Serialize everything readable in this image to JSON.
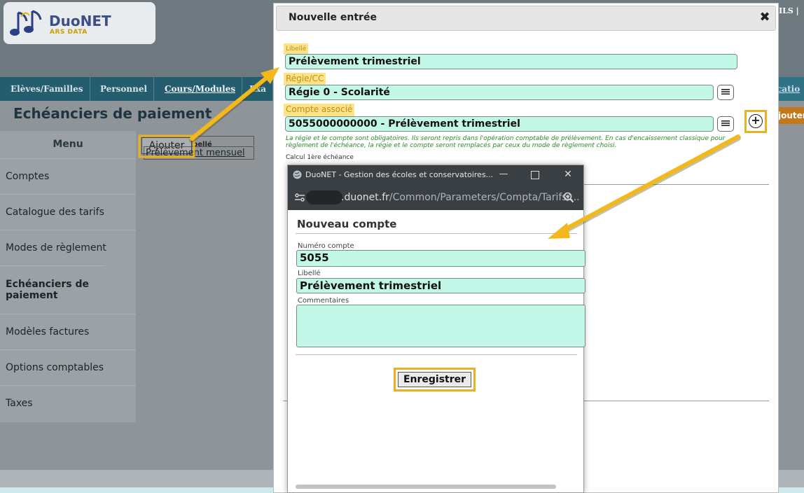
{
  "app": {
    "brand_name": "DuoNET",
    "brand_sub": "ARS DATA",
    "top_right_fragment": "ILS |"
  },
  "nav": {
    "items": [
      {
        "label": "Elèves/Familles"
      },
      {
        "label": "Personnel"
      },
      {
        "label": "Cours/Modules"
      },
      {
        "label": "Exa"
      }
    ],
    "right_fragment": "ocatio"
  },
  "page": {
    "title": "Echéanciers de paiement",
    "right_button_fragment": "jouter"
  },
  "sidebar": {
    "title": "Menu",
    "items": [
      {
        "label": "Comptes"
      },
      {
        "label": "Catalogue des tarifs"
      },
      {
        "label": "Modes de règlement"
      },
      {
        "label": "Echéanciers de paiement"
      },
      {
        "label": "Modèles factures"
      },
      {
        "label": "Options comptables"
      },
      {
        "label": "Taxes"
      }
    ]
  },
  "background_list": {
    "add_button": "Ajouter",
    "column_header": "Libellé",
    "rows": [
      "Prélèvement mensuel"
    ]
  },
  "modal": {
    "title": "Nouvelle entrée",
    "close_glyph": "✖",
    "libelle_label": "Libellé",
    "libelle_value": "Prélèvement trimestriel",
    "regie_label": "Régie/CC",
    "regie_value": "Régie 0 - Scolarité",
    "compte_label": "Compte associé",
    "compte_value": "5055000000000 - Prélèvement trimestriel",
    "add_glyph": "+",
    "note": "La régie et le compte sont obligatoires. Ils seront repris dans l'opération comptable de prélèvement. En cas d'encaissement classique pour règlement de l'échéance, la régie et le compte seront remplacés par ceux du mode de règlement choisi.",
    "calc_label": "Calcul 1ère échéance"
  },
  "popup": {
    "window_title": "DuoNET - Gestion des écoles et conservatoires...",
    "url_host": ".duonet.fr",
    "url_path": "/Common/Parameters/Compta/Tarifs/...",
    "heading": "Nouveau compte",
    "numero_label": "Numéro compte",
    "numero_value": "5055",
    "libelle_label": "Libellé",
    "libelle_value": "Prélèvement trimestriel",
    "commentaires_label": "Commentaires",
    "commentaires_value": "",
    "save_button": "Enregistrer",
    "min_glyph": "—",
    "close_glyph": "✕"
  },
  "colors": {
    "field_bg": "#c3f8e8",
    "highlight": "#e8b323",
    "nav_bg": "#235d6e",
    "label_highlight_bg": "#fde28a"
  }
}
